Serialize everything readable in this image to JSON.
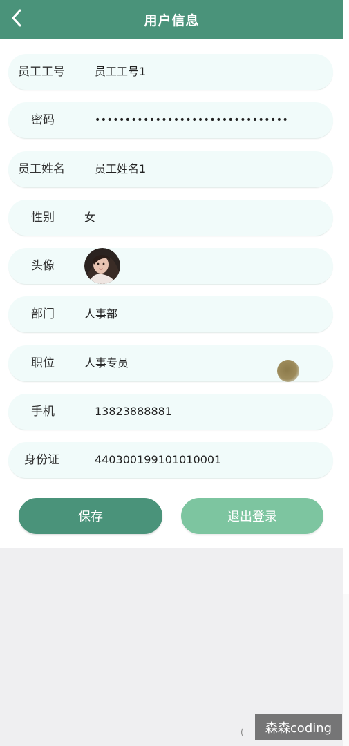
{
  "header": {
    "title": "用户信息",
    "back_icon": "chevron-left-icon"
  },
  "form": {
    "employee_no": {
      "label": "员工工号",
      "value": "员工工号1"
    },
    "password": {
      "label": "密码",
      "value": "••••••••••••••••••••••••••••••••"
    },
    "employee_name": {
      "label": "员工姓名",
      "value": "员工姓名1"
    },
    "gender": {
      "label": "性别",
      "value": "女"
    },
    "avatar": {
      "label": "头像"
    },
    "department": {
      "label": "部门",
      "value": "人事部"
    },
    "position": {
      "label": "职位",
      "value": "人事专员"
    },
    "phone": {
      "label": "手机",
      "value": "13823888881"
    },
    "id_card": {
      "label": "身份证",
      "value": "440300199101010001"
    }
  },
  "actions": {
    "save_label": "保存",
    "logout_label": "退出登录"
  },
  "watermark": {
    "text": "森森coding",
    "small_mark": "("
  },
  "colors": {
    "header": "#4a937a",
    "save_button": "#4a937a",
    "logout_button": "#7dc5a0",
    "row_background": "#f1fbfa"
  }
}
